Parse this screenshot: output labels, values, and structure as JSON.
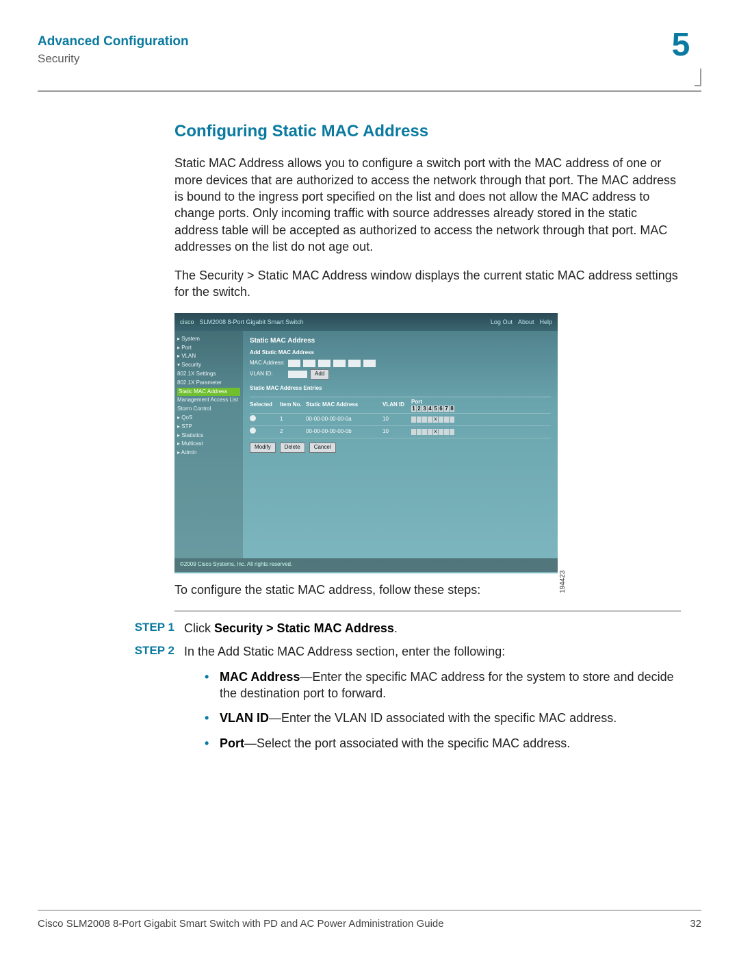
{
  "header": {
    "title": "Advanced Configuration",
    "subtitle": "Security",
    "chapter_number": "5"
  },
  "section_title": "Configuring Static MAC Address",
  "para1": "Static MAC Address allows you to configure a switch port with the MAC address of one or more devices that are authorized to access the network through that port. The MAC address is bound to the ingress port specified on the list and does not allow the MAC address to change ports. Only incoming traffic with source addresses already stored in the static address table will be accepted as authorized to access the network through that port. MAC addresses on the list do not age out.",
  "para2": "The Security > Static MAC Address window displays the current static MAC address settings for the switch.",
  "figure": {
    "brand": "cisco",
    "product": "SLM2008 8-Port Gigabit Smart Switch",
    "toplinks": [
      "Log Out",
      "About",
      "Help"
    ],
    "nav": [
      "▸ System",
      "▸ Port",
      "▸ VLAN",
      "▾ Security",
      "  802.1X Settings",
      "  802.1X Parameter",
      "  Static MAC Address",
      "  Management Access List",
      "  Storm Control",
      "▸ QoS",
      "▸ STP",
      "▸ Statistics",
      "▸ Multicast",
      "▸ Admin"
    ],
    "nav_selected_index": 6,
    "pane_title": "Static MAC Address",
    "add_heading": "Add Static MAC Address",
    "mac_label": "MAC Address:",
    "vlan_label": "VLAN ID:",
    "add_btn": "Add",
    "entries_heading": "Static MAC Address Entries",
    "cols": {
      "sel": "Selected",
      "item": "Item No.",
      "mac": "Static MAC Address",
      "vlan": "VLAN ID",
      "port": "Port"
    },
    "port_header_cells": [
      "1",
      "2",
      "3",
      "4",
      "5",
      "6",
      "7",
      "8"
    ],
    "rows": [
      {
        "item": "1",
        "mac": "00-00-00-00-00-0a",
        "vlan": "10",
        "port_mark": 5
      },
      {
        "item": "2",
        "mac": "00-00-00-00-00-0b",
        "vlan": "10",
        "port_mark": 5
      }
    ],
    "btns": [
      "Modify",
      "Delete",
      "Cancel"
    ],
    "copyright": "©2009 Cisco Systems, Inc. All rights reserved.",
    "fig_id": "194423"
  },
  "intro_steps": "To configure the static MAC address, follow these steps:",
  "steps": [
    {
      "label": "STEP 1",
      "pre": "Click ",
      "bold": "Security > Static MAC Address",
      "post": "."
    },
    {
      "label": "STEP 2",
      "text": "In the Add Static MAC Address section, enter the following:",
      "bullets": [
        {
          "lead": "MAC Address",
          "rest": "—Enter the specific MAC address for the system to store and decide the destination port to forward."
        },
        {
          "lead": "VLAN ID",
          "rest": "—Enter the VLAN ID associated with the specific MAC address."
        },
        {
          "lead": "Port",
          "rest": "—Select the port associated with the specific MAC address."
        }
      ]
    }
  ],
  "footer": {
    "left": "Cisco SLM2008 8-Port Gigabit Smart Switch with PD and AC Power Administration Guide",
    "right": "32"
  }
}
